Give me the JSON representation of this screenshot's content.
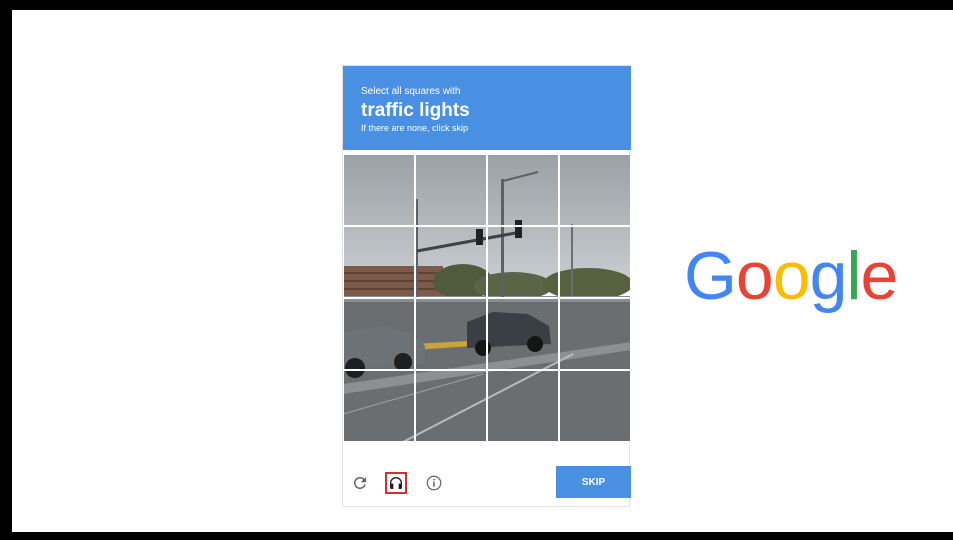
{
  "captcha": {
    "instruction": "Select all squares with",
    "target": "traffic lights",
    "hint": "If there are none, click skip",
    "grid": {
      "rows": 4,
      "cols": 4,
      "tiles": [
        {
          "index": 1
        },
        {
          "index": 2
        },
        {
          "index": 3
        },
        {
          "index": 4
        },
        {
          "index": 5
        },
        {
          "index": 6
        },
        {
          "index": 7
        },
        {
          "index": 8
        },
        {
          "index": 9
        },
        {
          "index": 10
        },
        {
          "index": 11
        },
        {
          "index": 12
        },
        {
          "index": 13
        },
        {
          "index": 14
        },
        {
          "index": 15
        },
        {
          "index": 16
        }
      ]
    },
    "footer": {
      "reload_icon": "reload-icon",
      "audio_icon": "headphones-icon",
      "info_icon": "info-icon",
      "skip_label": "SKIP"
    },
    "colors": {
      "accent": "#4a90e2",
      "highlight": "#d32f2f"
    }
  },
  "brand": {
    "letters": [
      "G",
      "o",
      "o",
      "g",
      "l",
      "e"
    ],
    "colors": [
      "#4285F4",
      "#EA4335",
      "#FBBC05",
      "#4285F4",
      "#34A853",
      "#EA4335"
    ]
  }
}
